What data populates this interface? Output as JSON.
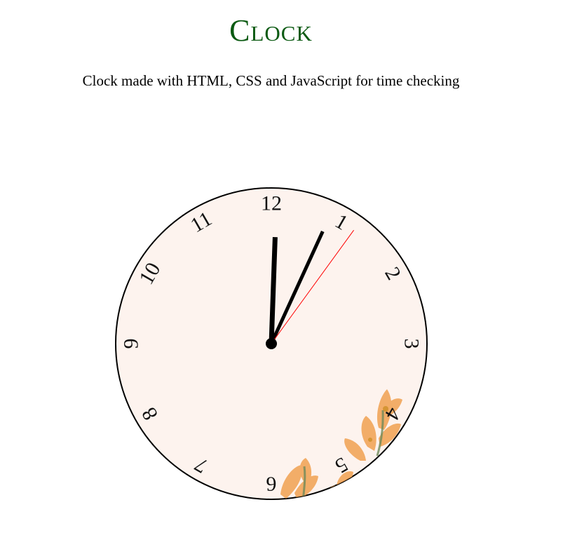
{
  "header": {
    "title": "Clock",
    "subtitle": "Clock made with HTML, CSS and JavaScript for time checking"
  },
  "clock": {
    "numerals": [
      "12",
      "1",
      "2",
      "3",
      "4",
      "5",
      "6",
      "7",
      "8",
      "9",
      "10",
      "11"
    ],
    "time": {
      "hours": 12,
      "minutes": 4,
      "seconds": 6
    },
    "colors": {
      "face": "#fdf3ee",
      "border": "#000000",
      "hour_hand": "#000000",
      "minute_hand": "#000000",
      "second_hand": "#ff0000",
      "flower": "#f0a050"
    }
  }
}
